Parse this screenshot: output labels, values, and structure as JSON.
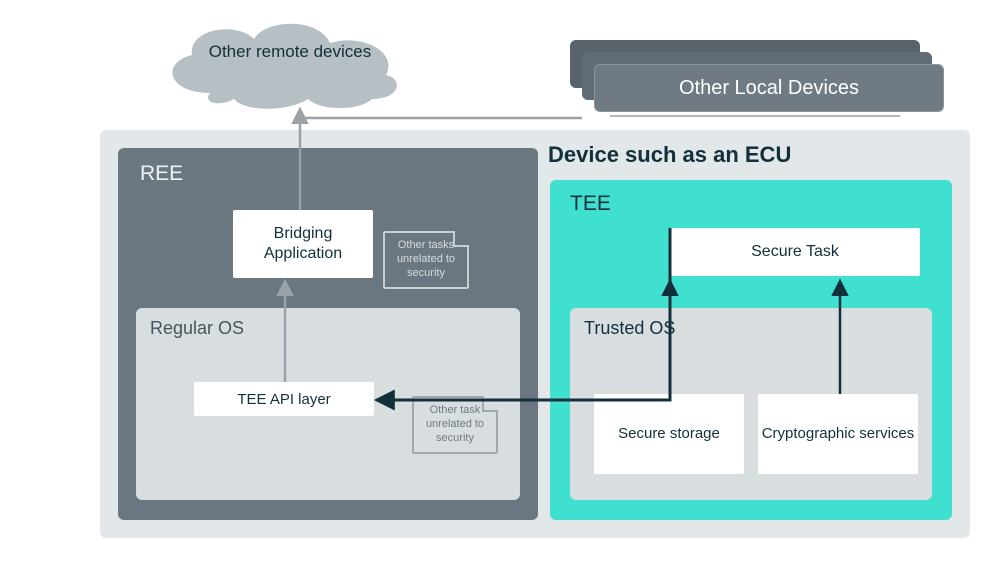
{
  "cloud": {
    "label": "Other remote devices"
  },
  "local_devices": {
    "label": "Other Local Devices"
  },
  "device": {
    "title": "Device such as an ECU"
  },
  "ree": {
    "title": "REE",
    "bridging": "Bridging Application",
    "note1": "Other tasks unrelated to security",
    "regular_os": {
      "title": "Regular OS",
      "tee_api": "TEE API layer",
      "note2": "Other task unrelated to security"
    }
  },
  "tee": {
    "title": "TEE",
    "secure_task": "Secure Task",
    "trusted_os": {
      "title": "Trusted OS",
      "secure_storage": "Secure storage",
      "crypto_services": "Cryptographic services"
    }
  }
}
